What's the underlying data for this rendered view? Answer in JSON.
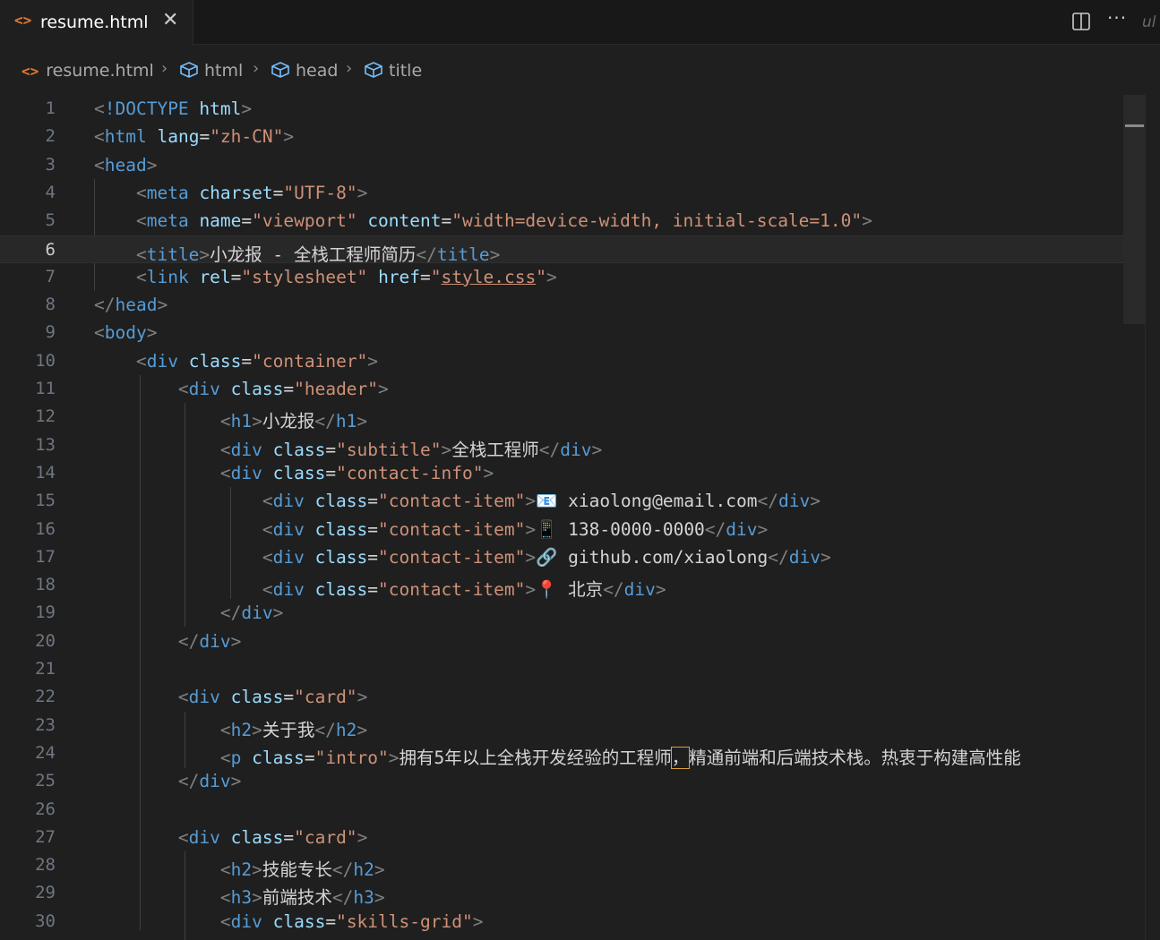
{
  "tab": {
    "filename": "resume.html",
    "close": "✕"
  },
  "edge_text": "ul",
  "breadcrumb": [
    "resume.html",
    "html",
    "head",
    "title"
  ],
  "code_lines": [
    {
      "n": "1",
      "html": "<span class=\"p\">&lt;</span><span class=\"t\">!DOCTYPE</span> <span class=\"a\">html</span><span class=\"p\">&gt;</span>"
    },
    {
      "n": "2",
      "html": "<span class=\"p\">&lt;</span><span class=\"t\">html</span> <span class=\"a\">lang</span>=<span class=\"s\">\"zh-CN\"</span><span class=\"p\">&gt;</span>"
    },
    {
      "n": "3",
      "html": "<span class=\"p\">&lt;</span><span class=\"t\">head</span><span class=\"p\">&gt;</span>"
    },
    {
      "n": "4",
      "html": "    <span class=\"p\">&lt;</span><span class=\"t\">meta</span> <span class=\"a\">charset</span>=<span class=\"s\">\"UTF-8\"</span><span class=\"p\">&gt;</span>"
    },
    {
      "n": "5",
      "html": "    <span class=\"p\">&lt;</span><span class=\"t\">meta</span> <span class=\"a\">name</span>=<span class=\"s\">\"viewport\"</span> <span class=\"a\">content</span>=<span class=\"s\">\"width=device-width, initial-scale=1.0\"</span><span class=\"p\">&gt;</span>"
    },
    {
      "n": "6",
      "html": "    <span class=\"p\">&lt;</span><span class=\"t\">title</span><span class=\"p\">&gt;</span>小龙报 - 全栈工程师简历<span class=\"p\">&lt;/</span><span class=\"t\">title</span><span class=\"p\">&gt;</span>"
    },
    {
      "n": "7",
      "html": "    <span class=\"p\">&lt;</span><span class=\"t\">link</span> <span class=\"a\">rel</span>=<span class=\"s\">\"stylesheet\"</span> <span class=\"a\">href</span>=<span class=\"s\">\"<span class=\"u\">style.css</span>\"</span><span class=\"p\">&gt;</span>"
    },
    {
      "n": "8",
      "html": "<span class=\"p\">&lt;/</span><span class=\"t\">head</span><span class=\"p\">&gt;</span>"
    },
    {
      "n": "9",
      "html": "<span class=\"p\">&lt;</span><span class=\"t\">body</span><span class=\"p\">&gt;</span>"
    },
    {
      "n": "10",
      "html": "    <span class=\"p\">&lt;</span><span class=\"t\">div</span> <span class=\"a\">class</span>=<span class=\"s\">\"container\"</span><span class=\"p\">&gt;</span>"
    },
    {
      "n": "11",
      "html": "        <span class=\"p\">&lt;</span><span class=\"t\">div</span> <span class=\"a\">class</span>=<span class=\"s\">\"header\"</span><span class=\"p\">&gt;</span>"
    },
    {
      "n": "12",
      "html": "            <span class=\"p\">&lt;</span><span class=\"t\">h1</span><span class=\"p\">&gt;</span>小龙报<span class=\"p\">&lt;/</span><span class=\"t\">h1</span><span class=\"p\">&gt;</span>"
    },
    {
      "n": "13",
      "html": "            <span class=\"p\">&lt;</span><span class=\"t\">div</span> <span class=\"a\">class</span>=<span class=\"s\">\"subtitle\"</span><span class=\"p\">&gt;</span>全栈工程师<span class=\"p\">&lt;/</span><span class=\"t\">div</span><span class=\"p\">&gt;</span>"
    },
    {
      "n": "14",
      "html": "            <span class=\"p\">&lt;</span><span class=\"t\">div</span> <span class=\"a\">class</span>=<span class=\"s\">\"contact-info\"</span><span class=\"p\">&gt;</span>"
    },
    {
      "n": "15",
      "html": "                <span class=\"p\">&lt;</span><span class=\"t\">div</span> <span class=\"a\">class</span>=<span class=\"s\">\"contact-item\"</span><span class=\"p\">&gt;</span>📧 xiaolong@email.com<span class=\"p\">&lt;/</span><span class=\"t\">div</span><span class=\"p\">&gt;</span>"
    },
    {
      "n": "16",
      "html": "                <span class=\"p\">&lt;</span><span class=\"t\">div</span> <span class=\"a\">class</span>=<span class=\"s\">\"contact-item\"</span><span class=\"p\">&gt;</span>📱 138-0000-0000<span class=\"p\">&lt;/</span><span class=\"t\">div</span><span class=\"p\">&gt;</span>"
    },
    {
      "n": "17",
      "html": "                <span class=\"p\">&lt;</span><span class=\"t\">div</span> <span class=\"a\">class</span>=<span class=\"s\">\"contact-item\"</span><span class=\"p\">&gt;</span>🔗 github.com/xiaolong<span class=\"p\">&lt;/</span><span class=\"t\">div</span><span class=\"p\">&gt;</span>"
    },
    {
      "n": "18",
      "html": "                <span class=\"p\">&lt;</span><span class=\"t\">div</span> <span class=\"a\">class</span>=<span class=\"s\">\"contact-item\"</span><span class=\"p\">&gt;</span>📍 北京<span class=\"p\">&lt;/</span><span class=\"t\">div</span><span class=\"p\">&gt;</span>"
    },
    {
      "n": "19",
      "html": "            <span class=\"p\">&lt;/</span><span class=\"t\">div</span><span class=\"p\">&gt;</span>"
    },
    {
      "n": "20",
      "html": "        <span class=\"p\">&lt;/</span><span class=\"t\">div</span><span class=\"p\">&gt;</span>"
    },
    {
      "n": "21",
      "html": ""
    },
    {
      "n": "22",
      "html": "        <span class=\"p\">&lt;</span><span class=\"t\">div</span> <span class=\"a\">class</span>=<span class=\"s\">\"card\"</span><span class=\"p\">&gt;</span>"
    },
    {
      "n": "23",
      "html": "            <span class=\"p\">&lt;</span><span class=\"t\">h2</span><span class=\"p\">&gt;</span>关于我<span class=\"p\">&lt;/</span><span class=\"t\">h2</span><span class=\"p\">&gt;</span>"
    },
    {
      "n": "24",
      "html": "            <span class=\"p\">&lt;</span><span class=\"t\">p</span> <span class=\"a\">class</span>=<span class=\"s\">\"intro\"</span><span class=\"p\">&gt;</span>拥有5年以上全栈开发经验的工程师<span class=\"hl\">，</span>精通前端和后端技术栈。热衷于构建高性能"
    },
    {
      "n": "25",
      "html": "        <span class=\"p\">&lt;/</span><span class=\"t\">div</span><span class=\"p\">&gt;</span>"
    },
    {
      "n": "26",
      "html": ""
    },
    {
      "n": "27",
      "html": "        <span class=\"p\">&lt;</span><span class=\"t\">div</span> <span class=\"a\">class</span>=<span class=\"s\">\"card\"</span><span class=\"p\">&gt;</span>"
    },
    {
      "n": "28",
      "html": "            <span class=\"p\">&lt;</span><span class=\"t\">h2</span><span class=\"p\">&gt;</span>技能专长<span class=\"p\">&lt;/</span><span class=\"t\">h2</span><span class=\"p\">&gt;</span>"
    },
    {
      "n": "29",
      "html": "            <span class=\"p\">&lt;</span><span class=\"t\">h3</span><span class=\"p\">&gt;</span>前端技术<span class=\"p\">&lt;/</span><span class=\"t\">h3</span><span class=\"p\">&gt;</span>"
    },
    {
      "n": "30",
      "html": "            <span class=\"p\">&lt;</span><span class=\"t\">div</span> <span class=\"a\">class</span>=<span class=\"s\">\"skills-grid\"</span><span class=\"p\">&gt;</span>"
    }
  ],
  "current_line": 6,
  "colors": {
    "tag": "#569cd6",
    "attr": "#9cdcfe",
    "string": "#ce9178",
    "punct": "#808080",
    "icon_accent": "#e37933",
    "breadcrumb_icon": "#75beff"
  }
}
